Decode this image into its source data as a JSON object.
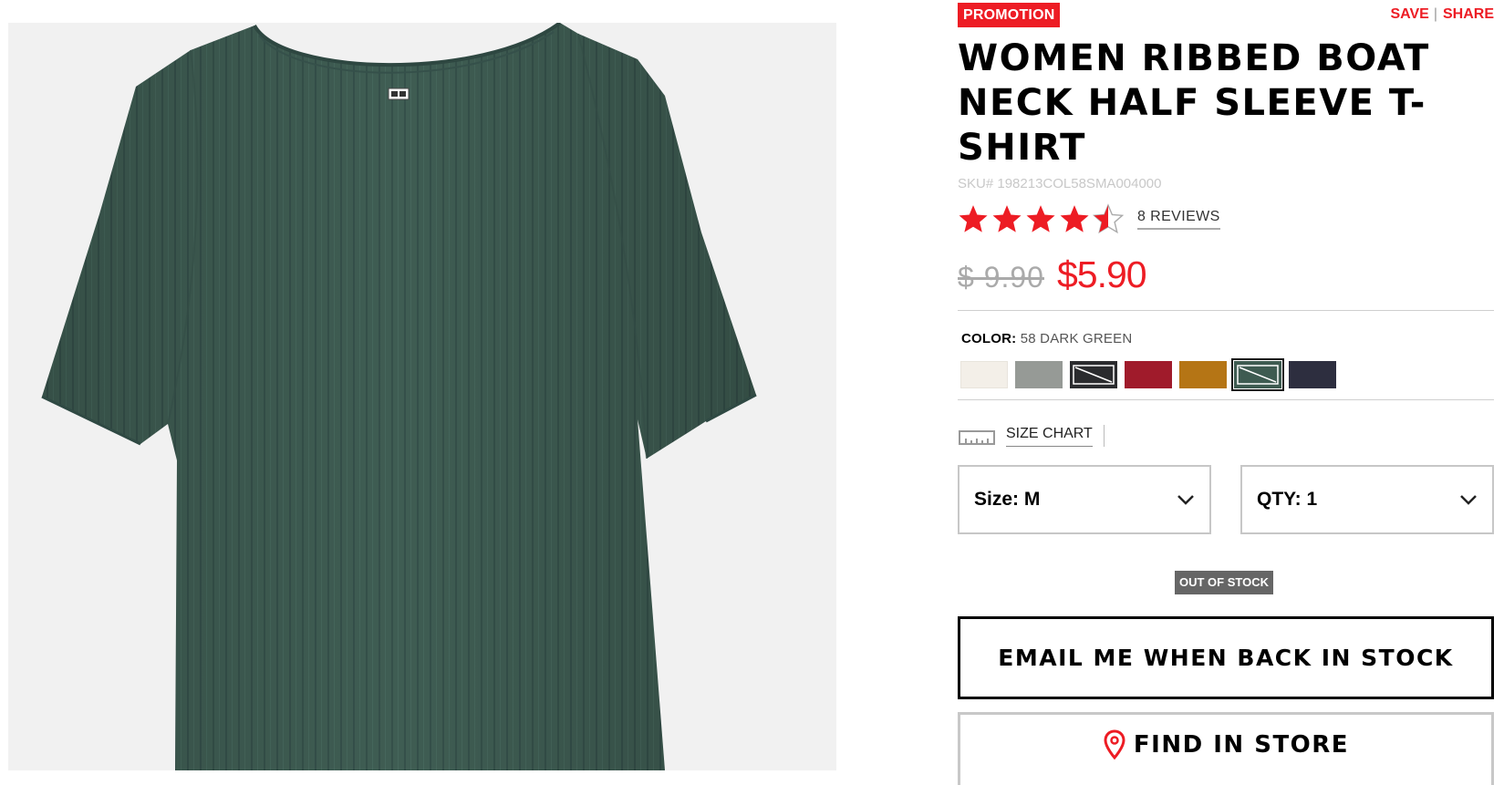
{
  "product": {
    "badge": "PROMOTION",
    "save_label": "SAVE",
    "share_label": "SHARE",
    "title": "WOMEN RIBBED BOAT NECK HALF SLEEVE T-SHIRT",
    "sku": "SKU# 198213COL58SMA004000",
    "rating": 4.5,
    "reviews_label": "8 REVIEWS",
    "old_price": "$ 9.90",
    "new_price": "$5.90",
    "image_alt_icon": "t-shirt-image"
  },
  "color": {
    "label": "COLOR:",
    "value": "58 DARK GREEN",
    "swatches": [
      {
        "color": "#f3efe8",
        "available": true,
        "selected": false
      },
      {
        "color": "#969a96",
        "available": true,
        "selected": false
      },
      {
        "color": "#2a2b2e",
        "available": false,
        "selected": false
      },
      {
        "color": "#a01b2b",
        "available": true,
        "selected": false
      },
      {
        "color": "#b57515",
        "available": true,
        "selected": false
      },
      {
        "color": "#3e5b51",
        "available": false,
        "selected": true
      },
      {
        "color": "#2d2e3f",
        "available": true,
        "selected": false
      }
    ]
  },
  "size_chart_label": "SIZE CHART",
  "size_select": {
    "label": "Size: M"
  },
  "qty_select": {
    "label": "QTY: 1"
  },
  "stock_status": "OUT OF STOCK",
  "buttons": {
    "email": "EMAIL ME WHEN BACK IN STOCK",
    "find": "FIND IN STORE"
  },
  "colors": {
    "accent": "#ed1c24",
    "shirt": "#3f5d53"
  }
}
